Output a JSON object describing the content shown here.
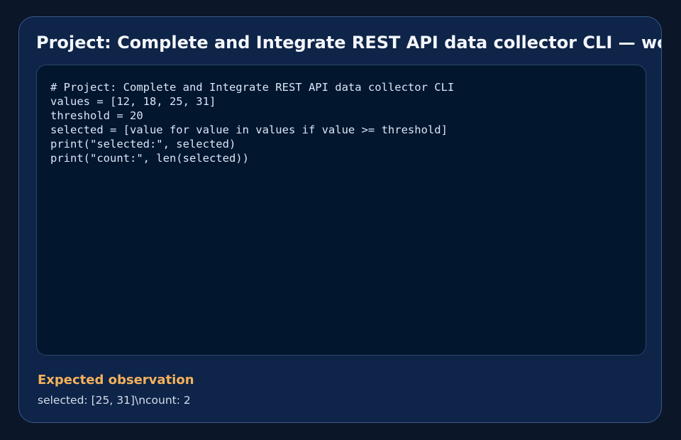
{
  "card": {
    "title": "Project: Complete and Integrate REST API data collector CLI — worked example"
  },
  "code": {
    "lines": [
      "# Project: Complete and Integrate REST API data collector CLI",
      "values = [12, 18, 25, 31]",
      "threshold = 20",
      "selected = [value for value in values if value >= threshold]",
      "print(\"selected:\", selected)",
      "print(\"count:\", len(selected))"
    ]
  },
  "observation": {
    "heading": "Expected observation",
    "text": "selected: [25, 31]\\ncount: 2"
  },
  "colors": {
    "background": "#0b1628",
    "card": "#0e2448",
    "code_panel": "#02162e",
    "accent": "#f5b25c",
    "text": "#f4f6fb"
  }
}
